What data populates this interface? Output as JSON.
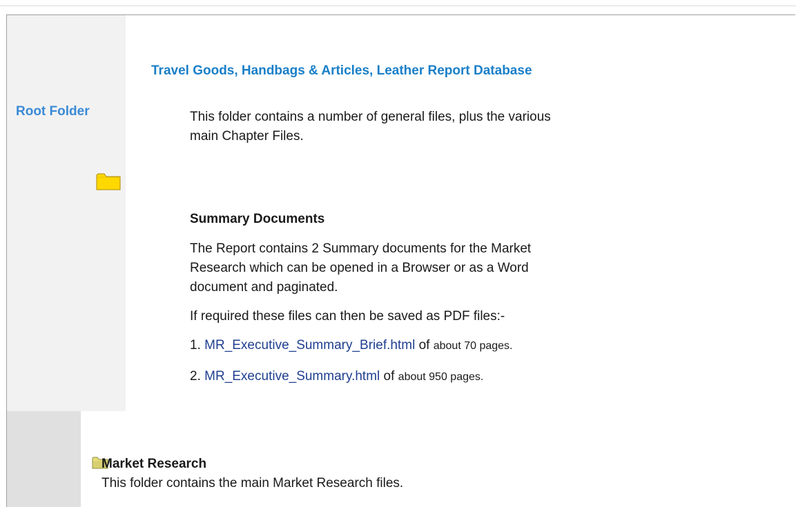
{
  "page": {
    "title": "Travel Goods, Handbags & Articles, Leather Report Database",
    "sidebar_label": "Root Folder"
  },
  "root_folder": {
    "icon": "folder-icon",
    "intro": "This folder contains a number of general files, plus the various main Chapter Files."
  },
  "summary": {
    "heading": "Summary Documents",
    "description": "The Report contains 2 Summary documents for the Market Research which can be opened in a Browser or as a Word document and paginated.",
    "pdf_note": "If required these files can then be saved as PDF files:-",
    "items": [
      {
        "number": "1.",
        "link": "MR_Executive_Summary_Brief.html",
        "of": "of",
        "pages": "about 70 pages."
      },
      {
        "number": "2.",
        "link": "MR_Executive_Summary.html",
        "of": "of",
        "pages": "about 950 pages."
      }
    ]
  },
  "market_research": {
    "icon": "folder-icon",
    "title": "Market Research",
    "description": "This folder contains the main Market Research files."
  },
  "colors": {
    "title_blue": "#1a7fc8",
    "label_blue": "#3a8ad6",
    "link_blue": "#1f3f8f",
    "folder_yellow": "#ffd800"
  }
}
